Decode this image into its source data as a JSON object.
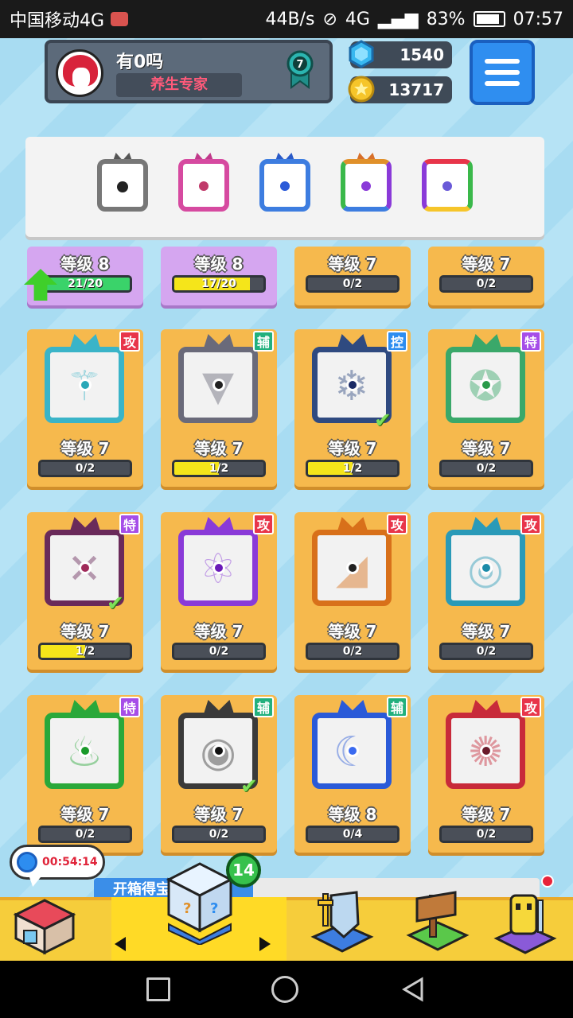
{
  "status_bar": {
    "carrier": "中国移动4G",
    "speed": "44B/s",
    "network": "4G",
    "battery": "83%",
    "time": "07:57"
  },
  "profile": {
    "name": "有0吗",
    "title": "养生专家",
    "badge_level": "7"
  },
  "resources": {
    "gems": "1540",
    "coins": "13717"
  },
  "colors": {
    "gray": "#6f6f6f",
    "pink": "#d64aa0",
    "blue": "#3d7de0",
    "rainbow": "#e0902a",
    "attack": "#e8354a",
    "support": "#22b07d",
    "control": "#2d8df0",
    "special": "#a64ee8"
  },
  "filters": [
    {
      "name": "all-filter",
      "icon": "target-icon"
    },
    {
      "name": "pink-filter",
      "icon": "crossed-icon"
    },
    {
      "name": "blue-filter",
      "icon": "snowflake-icon"
    },
    {
      "name": "rainbow-filter",
      "icon": "infinity-icon"
    },
    {
      "name": "prism-filter",
      "icon": "diamond-icon"
    }
  ],
  "top_row": [
    {
      "level": "等级 8",
      "progress": "21/20",
      "fill": 1.0,
      "bg": "purple",
      "upgrade": true
    },
    {
      "level": "等级 8",
      "progress": "17/20",
      "fill": 0.85,
      "bg": "purple",
      "upgrade": false
    },
    {
      "level": "等级 7",
      "progress": "0/2",
      "fill": 0,
      "bg": "orange",
      "upgrade": false
    },
    {
      "level": "等级 7",
      "progress": "0/2",
      "fill": 0,
      "bg": "orange",
      "upgrade": false
    }
  ],
  "cards": [
    {
      "level": "等级 7",
      "progress": "0/2",
      "fill": 0,
      "tag": "攻",
      "tag_type": "atk",
      "frame": "#3ab4c8",
      "dot": "#2aa8b8",
      "check": false,
      "icon": "totem-icon"
    },
    {
      "level": "等级 7",
      "progress": "1/2",
      "fill": 0.5,
      "tag": "辅",
      "tag_type": "sup",
      "frame": "#6a6a7a",
      "dot": "#222",
      "check": false,
      "icon": "fangs-icon"
    },
    {
      "level": "等级 7",
      "progress": "1/2",
      "fill": 0.5,
      "tag": "控",
      "tag_type": "ctl",
      "frame": "#2f4a80",
      "dot": "#1a2a66",
      "check": true,
      "icon": "snowflake-icon"
    },
    {
      "level": "等级 7",
      "progress": "0/2",
      "fill": 0,
      "tag": "特",
      "tag_type": "spc",
      "frame": "#3aa86a",
      "dot": "#2a9a4a",
      "check": false,
      "icon": "pentagram-icon"
    },
    {
      "level": "等级 7",
      "progress": "1/2",
      "fill": 0.5,
      "tag": "特",
      "tag_type": "spc",
      "frame": "#6a2a5a",
      "dot": "#a02a5a",
      "check": true,
      "icon": "syringe-icon"
    },
    {
      "level": "等级 7",
      "progress": "0/2",
      "fill": 0,
      "tag": "攻",
      "tag_type": "atk",
      "frame": "#8a3ad8",
      "dot": "#6a1ab8",
      "check": false,
      "icon": "atom-icon"
    },
    {
      "level": "等级 7",
      "progress": "0/2",
      "fill": 0,
      "tag": "攻",
      "tag_type": "atk",
      "frame": "#d8701a",
      "dot": "#222",
      "check": false,
      "icon": "pistol-icon"
    },
    {
      "level": "等级 7",
      "progress": "0/2",
      "fill": 0,
      "tag": "攻",
      "tag_type": "atk",
      "frame": "#2a9ab8",
      "dot": "#1a8aa8",
      "check": false,
      "icon": "vortex-icon"
    },
    {
      "level": "等级 7",
      "progress": "0/2",
      "fill": 0,
      "tag": "特",
      "tag_type": "spc",
      "frame": "#2aa83a",
      "dot": "#1a9a2a",
      "check": false,
      "icon": "flame-icon"
    },
    {
      "level": "等级 7",
      "progress": "0/2",
      "fill": 0,
      "tag": "辅",
      "tag_type": "sup",
      "frame": "#3a3a3a",
      "dot": "#111",
      "check": true,
      "icon": "target-icon"
    },
    {
      "level": "等级 8",
      "progress": "0/4",
      "fill": 0,
      "tag": "辅",
      "tag_type": "sup",
      "frame": "#2a5ad8",
      "dot": "#3a6af0",
      "check": false,
      "icon": "crescent-icon"
    },
    {
      "level": "等级 7",
      "progress": "0/2",
      "fill": 0,
      "tag": "攻",
      "tag_type": "atk",
      "frame": "#c82a3a",
      "dot": "#6a1a2a",
      "check": false,
      "icon": "saw-icon"
    }
  ],
  "timer": {
    "text": "00:54:14"
  },
  "banner": {
    "text": "开箱得宝物"
  },
  "bottom_nav": {
    "box_count": "14",
    "items": [
      "shop-icon",
      "mystery-box-icon",
      "hero-shield-icon",
      "map-board-icon",
      "character-icon"
    ]
  }
}
